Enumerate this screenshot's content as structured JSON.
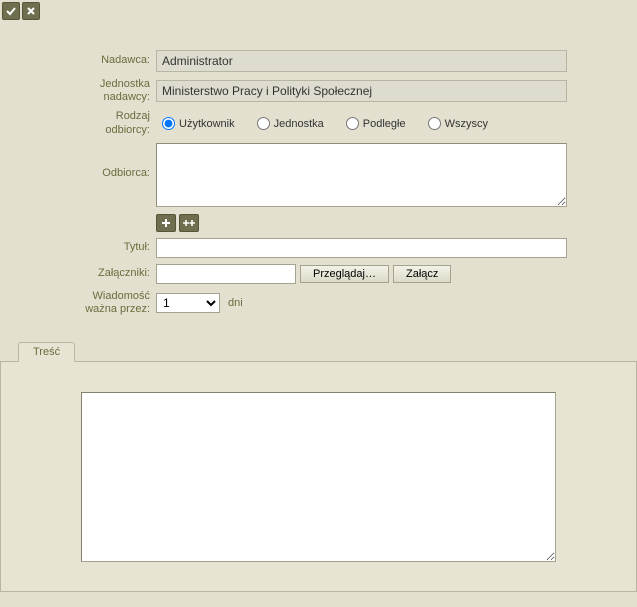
{
  "toolbar": {
    "ok_icon": "ok-icon",
    "cancel_icon": "cancel-icon"
  },
  "form": {
    "sender_label": "Nadawca:",
    "sender_value": "Administrator",
    "sender_unit_label_line1": "Jednostka",
    "sender_unit_label_line2": "nadawcy:",
    "sender_unit_value": "Ministerstwo Pracy i Polityki Społecznej",
    "recipient_type_label_line1": "Rodzaj",
    "recipient_type_label_line2": "odbiorcy:",
    "recipient_type": {
      "options": [
        {
          "label": "Użytkownik",
          "checked": true
        },
        {
          "label": "Jednostka",
          "checked": false
        },
        {
          "label": "Podległe",
          "checked": false
        },
        {
          "label": "Wszyscy",
          "checked": false
        }
      ]
    },
    "recipient_label": "Odbiorca:",
    "recipient_value": "",
    "recipient_buttons": {
      "add_icon": "plus-icon",
      "add_group_icon": "plus-group-icon"
    },
    "title_label": "Tytuł:",
    "title_value": "",
    "attachments_label": "Załączniki:",
    "attachments_value": "",
    "browse_btn": "Przeglądaj…",
    "attach_btn": "Załącz",
    "validity_label_line1": "Wiadomość",
    "validity_label_line2": "ważna przez:",
    "validity_value": "1",
    "validity_unit": "dni"
  },
  "tabs": {
    "content_label": "Treść"
  },
  "body_value": ""
}
